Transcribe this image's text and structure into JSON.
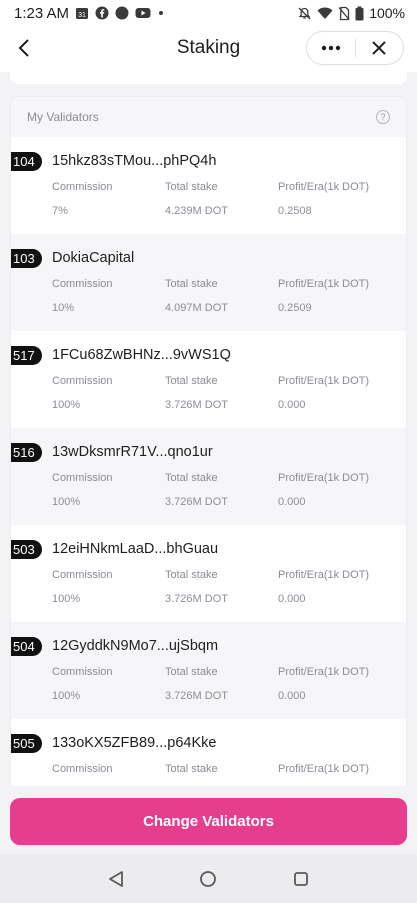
{
  "status_bar": {
    "time": "1:23 AM",
    "calendar_day": "31",
    "battery": "100%",
    "icons": [
      "calendar-icon",
      "facebook-icon",
      "circle-icon",
      "youtube-icon",
      "dot-icon",
      "mute-icon",
      "wifi-icon",
      "no-sim-icon",
      "battery-icon"
    ]
  },
  "header": {
    "title": "Staking",
    "back_icon": "chevron-left-icon",
    "more_icon": "more-dots-icon",
    "close_icon": "close-icon"
  },
  "validators": {
    "section_title": "My Validators",
    "help_glyph": "?",
    "rows": [
      {
        "rank": "104",
        "name": "15hkz83sTMou...phPQ4h",
        "commission_label": "Commission",
        "stake_label": "Total stake",
        "profit_label": "Profit/Era(1k DOT)",
        "commission": "7%",
        "stake": "4.239M DOT",
        "profit": "0.2508"
      },
      {
        "rank": "103",
        "name": "DokiaCapital",
        "commission_label": "Commission",
        "stake_label": "Total stake",
        "profit_label": "Profit/Era(1k DOT)",
        "commission": "10%",
        "stake": "4.097M DOT",
        "profit": "0.2509"
      },
      {
        "rank": "517",
        "name": "1FCu68ZwBHNz...9vWS1Q",
        "commission_label": "Commission",
        "stake_label": "Total stake",
        "profit_label": "Profit/Era(1k DOT)",
        "commission": "100%",
        "stake": "3.726M DOT",
        "profit": "0.000"
      },
      {
        "rank": "516",
        "name": "13wDksmrR71V...qno1ur",
        "commission_label": "Commission",
        "stake_label": "Total stake",
        "profit_label": "Profit/Era(1k DOT)",
        "commission": "100%",
        "stake": "3.726M DOT",
        "profit": "0.000"
      },
      {
        "rank": "503",
        "name": "12eiHNkmLaaD...bhGuau",
        "commission_label": "Commission",
        "stake_label": "Total stake",
        "profit_label": "Profit/Era(1k DOT)",
        "commission": "100%",
        "stake": "3.726M DOT",
        "profit": "0.000"
      },
      {
        "rank": "504",
        "name": "12GyddkN9Mo7...ujSbqm",
        "commission_label": "Commission",
        "stake_label": "Total stake",
        "profit_label": "Profit/Era(1k DOT)",
        "commission": "100%",
        "stake": "3.726M DOT",
        "profit": "0.000"
      },
      {
        "rank": "505",
        "name": "133oKX5ZFB89...p64Kke",
        "commission_label": "Commission",
        "stake_label": "Total stake",
        "profit_label": "Profit/Era(1k DOT)",
        "commission": "",
        "stake": "",
        "profit": ""
      }
    ]
  },
  "action": {
    "change_label": "Change Validators",
    "accent_color": "#e63d8f"
  },
  "nav_bar": {
    "icons": [
      "back-triangle-icon",
      "home-circle-icon",
      "recents-square-icon"
    ]
  }
}
